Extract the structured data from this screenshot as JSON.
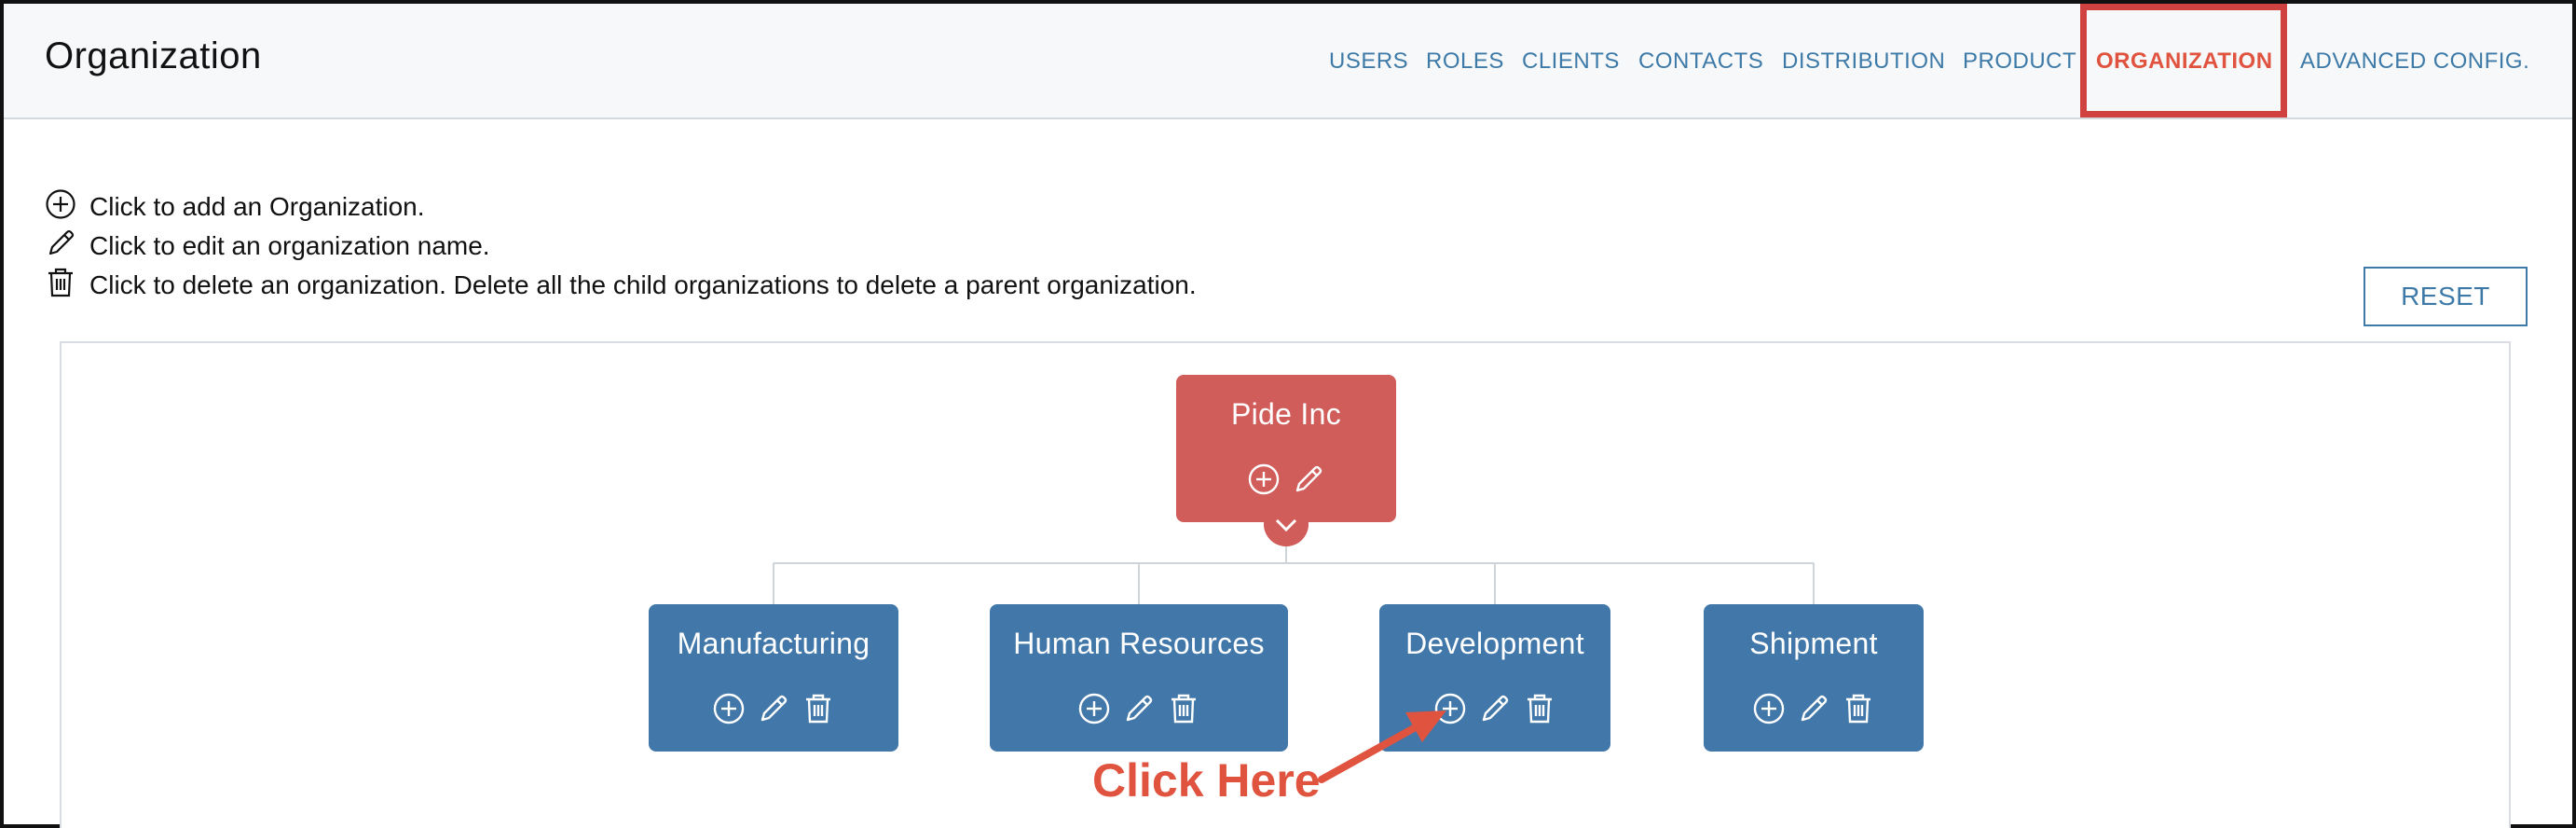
{
  "header": {
    "title": "Organization",
    "nav": [
      {
        "label": "USERS",
        "active": false
      },
      {
        "label": "ROLES",
        "active": false
      },
      {
        "label": "CLIENTS",
        "active": false
      },
      {
        "label": "CONTACTS",
        "active": false
      },
      {
        "label": "DISTRIBUTION",
        "active": false
      },
      {
        "label": "PRODUCT",
        "active": false
      },
      {
        "label": "ORGANIZATION",
        "active": true
      },
      {
        "label": "ADVANCED CONFIG.",
        "active": false
      }
    ]
  },
  "legend": {
    "add": {
      "icon": "plus-circle-icon",
      "text": "Click to add an Organization."
    },
    "edit": {
      "icon": "pencil-icon",
      "text": "Click to edit an organization name."
    },
    "delete": {
      "icon": "trash-icon",
      "text": "Click to delete an organization. Delete all the child organizations to delete a parent organization."
    }
  },
  "reset_label": "RESET",
  "tree": {
    "root": {
      "name": "Pide Inc"
    },
    "children": [
      {
        "name": "Manufacturing"
      },
      {
        "name": "Human Resources"
      },
      {
        "name": "Development"
      },
      {
        "name": "Shipment"
      }
    ]
  },
  "annotation": {
    "text": "Click Here"
  },
  "colors": {
    "root_node": "#d05d5a",
    "child_node": "#4278a9",
    "nav_link": "#3d7aa8",
    "nav_active": "#e0533f",
    "highlight_box": "#d0423f",
    "annotation": "#e0533f"
  }
}
